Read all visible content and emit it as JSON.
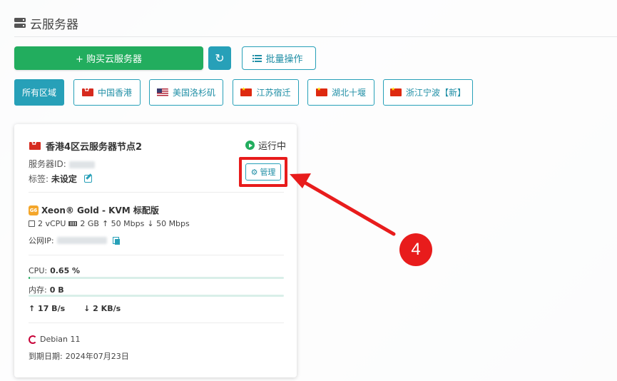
{
  "header": {
    "title": "云服务器"
  },
  "toolbar": {
    "buy_label": "+ 购买云服务器",
    "refresh_icon": "↻",
    "batch_label": "批量操作"
  },
  "regions": [
    {
      "label": "所有区域",
      "active": true
    },
    {
      "label": "中国香港",
      "flag": "hk"
    },
    {
      "label": "美国洛杉矶",
      "flag": "us"
    },
    {
      "label": "江苏宿迁",
      "flag": "cn"
    },
    {
      "label": "湖北十堰",
      "flag": "cn"
    },
    {
      "label": "浙江宁波【新】",
      "flag": "cn"
    }
  ],
  "card": {
    "node_title": "香港4区云服务器节点2",
    "status": "运行中",
    "server_id_label": "服务器ID:",
    "tag_label": "标签:",
    "tag_value": "未设定",
    "manage_label": "管理",
    "cpu_model": "Xeon® Gold - KVM 标配版",
    "generation_badge": "G6",
    "vcpu": "2 vCPU",
    "ram": "2 GB",
    "up_speed": "↑ 50 Mbps",
    "down_speed": "↓ 50 Mbps",
    "ip_label": "公网IP:",
    "cpu_label": "CPU:",
    "cpu_value": "0.65 %",
    "cpu_percent": 0.65,
    "mem_label": "内存:",
    "mem_value": "0 B",
    "mem_percent": 0,
    "net_up": "↑ 17 B/s",
    "net_down": "↓ 2 KB/s",
    "os": "Debian 11",
    "expire_label": "到期日期:",
    "expire_date": "2024年07月23日"
  },
  "annotation": {
    "step": "4"
  },
  "colors": {
    "primary": "#27a0b8",
    "green": "#22ad5e",
    "red": "#e81c1c"
  }
}
